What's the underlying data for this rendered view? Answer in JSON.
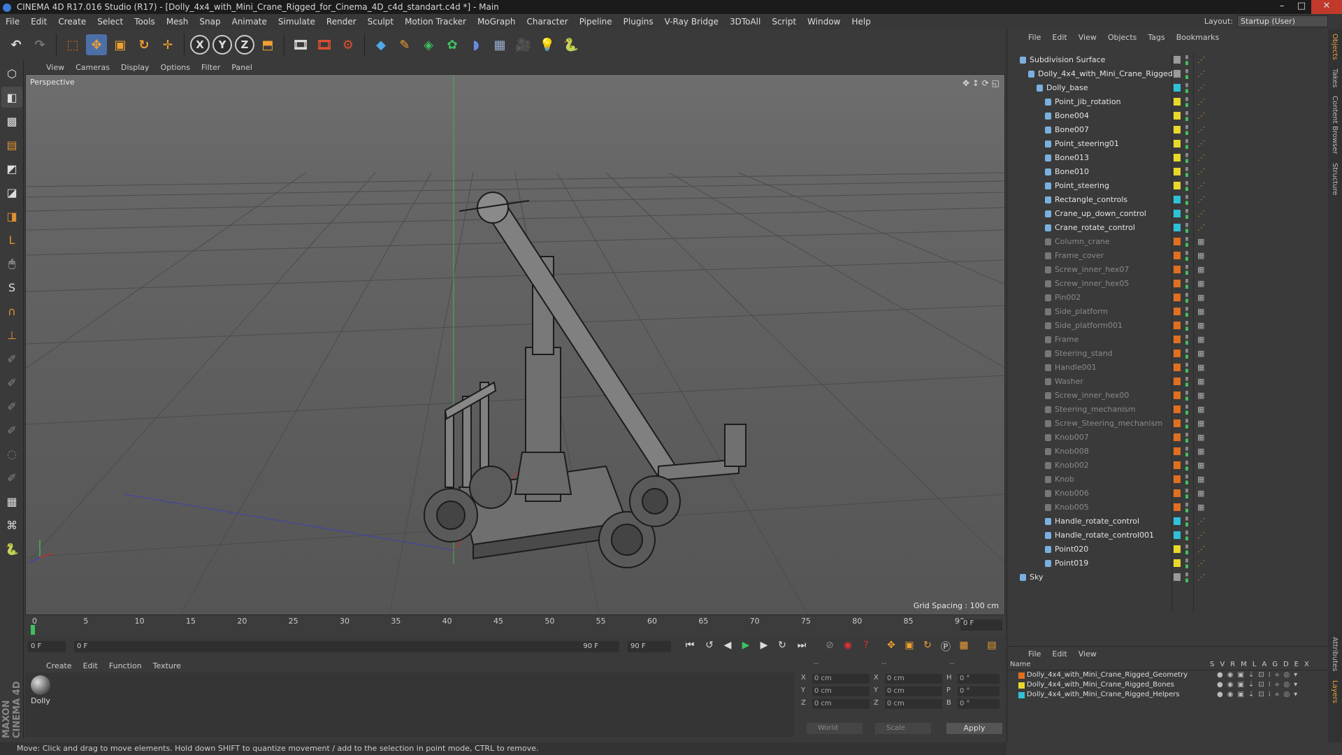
{
  "window": {
    "title": "CINEMA 4D R17.016 Studio (R17) - [Dolly_4x4_with_Mini_Crane_Rigged_for_Cinema_4D_c4d_standart.c4d *] - Main"
  },
  "menubar": {
    "items": [
      "File",
      "Edit",
      "Create",
      "Select",
      "Tools",
      "Mesh",
      "Snap",
      "Animate",
      "Simulate",
      "Render",
      "Sculpt",
      "Motion Tracker",
      "MoGraph",
      "Character",
      "Pipeline",
      "Plugins",
      "V-Ray Bridge",
      "3DToAll",
      "Script",
      "Window",
      "Help"
    ],
    "layout_label": "Layout:",
    "layout_value": "Startup (User)"
  },
  "toolbar": {
    "icons": [
      "undo-icon",
      "redo-icon",
      "live-selection-icon",
      "move-icon",
      "scale-icon",
      "rotate-icon",
      "transform-icon",
      "x-axis-icon",
      "y-axis-icon",
      "z-axis-icon",
      "coordinate-system-icon",
      "render-view-icon",
      "render-picture-viewer-icon",
      "render-settings-icon",
      "cube-icon",
      "spline-pen-icon",
      "subdivision-icon",
      "array-icon",
      "deformer-icon",
      "floor-icon",
      "camera-icon",
      "light-icon",
      "python-icon"
    ],
    "axis_x": "X",
    "axis_y": "Y",
    "axis_z": "Z"
  },
  "viewport": {
    "menu": [
      "View",
      "Cameras",
      "Display",
      "Options",
      "Filter",
      "Panel"
    ],
    "label": "Perspective",
    "grid_spacing": "Grid Spacing : 100 cm"
  },
  "timeline": {
    "ticks": [
      "0",
      "5",
      "10",
      "15",
      "20",
      "25",
      "30",
      "35",
      "40",
      "45",
      "50",
      "55",
      "60",
      "65",
      "70",
      "75",
      "80",
      "85",
      "90"
    ],
    "current_frame": "0 F",
    "start_field": "0 F",
    "range_start": "0 F",
    "range_end": "90 F",
    "end_field": "90 F"
  },
  "materials": {
    "menu": [
      "Create",
      "Edit",
      "Function",
      "Texture"
    ],
    "items": [
      {
        "name": "Dolly"
      }
    ]
  },
  "coordinates": {
    "headers": [
      "--",
      "--",
      "--"
    ],
    "rows": [
      {
        "a": "X",
        "av": "0 cm",
        "b": "X",
        "bv": "0 cm",
        "c": "H",
        "cv": "0 °"
      },
      {
        "a": "Y",
        "av": "0 cm",
        "b": "Y",
        "bv": "0 cm",
        "c": "P",
        "cv": "0 °"
      },
      {
        "a": "Z",
        "av": "0 cm",
        "b": "Z",
        "bv": "0 cm",
        "c": "B",
        "cv": "0 °"
      }
    ],
    "mode": "World",
    "scale": "Scale",
    "apply": "Apply"
  },
  "status": {
    "text": "Move: Click and drag to move elements. Hold down SHIFT to quantize movement / add to the selection in point mode, CTRL to remove."
  },
  "object_manager": {
    "menu": [
      "File",
      "Edit",
      "View",
      "Objects",
      "Tags",
      "Bookmarks"
    ],
    "objects": [
      {
        "name": "Subdivision Surface",
        "depth": 0,
        "color": "#9a9a9a",
        "dim": false
      },
      {
        "name": "Dolly_4x4_with_Mini_Crane_Rigged",
        "depth": 1,
        "color": "#9a9a9a",
        "dim": false
      },
      {
        "name": "Dolly_base",
        "depth": 2,
        "color": "#2fc1d9",
        "dim": false
      },
      {
        "name": "Point_jib_rotation",
        "depth": 3,
        "color": "#e8d82c",
        "dim": false
      },
      {
        "name": "Bone004",
        "depth": 3,
        "color": "#e8d82c",
        "dim": false
      },
      {
        "name": "Bone007",
        "depth": 3,
        "color": "#e8d82c",
        "dim": false
      },
      {
        "name": "Point_steering01",
        "depth": 3,
        "color": "#e8d82c",
        "dim": false
      },
      {
        "name": "Bone013",
        "depth": 3,
        "color": "#e8d82c",
        "dim": false
      },
      {
        "name": "Bone010",
        "depth": 3,
        "color": "#e8d82c",
        "dim": false
      },
      {
        "name": "Point_steering",
        "depth": 3,
        "color": "#e8d82c",
        "dim": false
      },
      {
        "name": "Rectangle_controls",
        "depth": 3,
        "color": "#2fc1d9",
        "dim": false
      },
      {
        "name": "Crane_up_down_control",
        "depth": 3,
        "color": "#2fc1d9",
        "dim": false
      },
      {
        "name": "Crane_rotate_control",
        "depth": 3,
        "color": "#2fc1d9",
        "dim": false
      },
      {
        "name": "Column_crane",
        "depth": 3,
        "color": "#e07020",
        "dim": true
      },
      {
        "name": "Frame_cover",
        "depth": 3,
        "color": "#e07020",
        "dim": true
      },
      {
        "name": "Screw_inner_hex07",
        "depth": 3,
        "color": "#e07020",
        "dim": true
      },
      {
        "name": "Screw_inner_hex05",
        "depth": 3,
        "color": "#e07020",
        "dim": true
      },
      {
        "name": "Pin002",
        "depth": 3,
        "color": "#e07020",
        "dim": true
      },
      {
        "name": "Side_platform",
        "depth": 3,
        "color": "#e07020",
        "dim": true
      },
      {
        "name": "Side_platform001",
        "depth": 3,
        "color": "#e07020",
        "dim": true
      },
      {
        "name": "Frame",
        "depth": 3,
        "color": "#e07020",
        "dim": true
      },
      {
        "name": "Steering_stand",
        "depth": 3,
        "color": "#e07020",
        "dim": true
      },
      {
        "name": "Handle001",
        "depth": 3,
        "color": "#e07020",
        "dim": true
      },
      {
        "name": "Washer",
        "depth": 3,
        "color": "#e07020",
        "dim": true
      },
      {
        "name": "Screw_inner_hex00",
        "depth": 3,
        "color": "#e07020",
        "dim": true
      },
      {
        "name": "Steering_mechanism",
        "depth": 3,
        "color": "#e07020",
        "dim": true
      },
      {
        "name": "Screw_Steering_mechanism",
        "depth": 3,
        "color": "#e07020",
        "dim": true
      },
      {
        "name": "Knob007",
        "depth": 3,
        "color": "#e07020",
        "dim": true
      },
      {
        "name": "Knob008",
        "depth": 3,
        "color": "#e07020",
        "dim": true
      },
      {
        "name": "Knob002",
        "depth": 3,
        "color": "#e07020",
        "dim": true
      },
      {
        "name": "Knob",
        "depth": 3,
        "color": "#e07020",
        "dim": true
      },
      {
        "name": "Knob006",
        "depth": 3,
        "color": "#e07020",
        "dim": true
      },
      {
        "name": "Knob005",
        "depth": 3,
        "color": "#e07020",
        "dim": true
      },
      {
        "name": "Handle_rotate_control",
        "depth": 3,
        "color": "#2fc1d9",
        "dim": false
      },
      {
        "name": "Handle_rotate_control001",
        "depth": 3,
        "color": "#2fc1d9",
        "dim": false
      },
      {
        "name": "Point020",
        "depth": 3,
        "color": "#e8d82c",
        "dim": false
      },
      {
        "name": "Point019",
        "depth": 3,
        "color": "#e8d82c",
        "dim": false
      },
      {
        "name": "Sky",
        "depth": 0,
        "color": "#9a9a9a",
        "dim": false
      }
    ]
  },
  "layer_manager": {
    "menu": [
      "File",
      "Edit",
      "View"
    ],
    "header_name": "Name",
    "header_flags": [
      "S",
      "V",
      "R",
      "M",
      "L",
      "A",
      "G",
      "D",
      "E",
      "X"
    ],
    "layers": [
      {
        "name": "Dolly_4x4_with_Mini_Crane_Rigged_Geometry",
        "color": "#e07020"
      },
      {
        "name": "Dolly_4x4_with_Mini_Crane_Rigged_Bones",
        "color": "#e8d82c"
      },
      {
        "name": "Dolly_4x4_with_Mini_Crane_Rigged_Helpers",
        "color": "#2fc1d9"
      }
    ]
  },
  "side_tabs": [
    "Objects",
    "Takes",
    "Content Browser",
    "Structure",
    "Attributes",
    "Layers"
  ],
  "brand": "MAXON CINEMA 4D"
}
